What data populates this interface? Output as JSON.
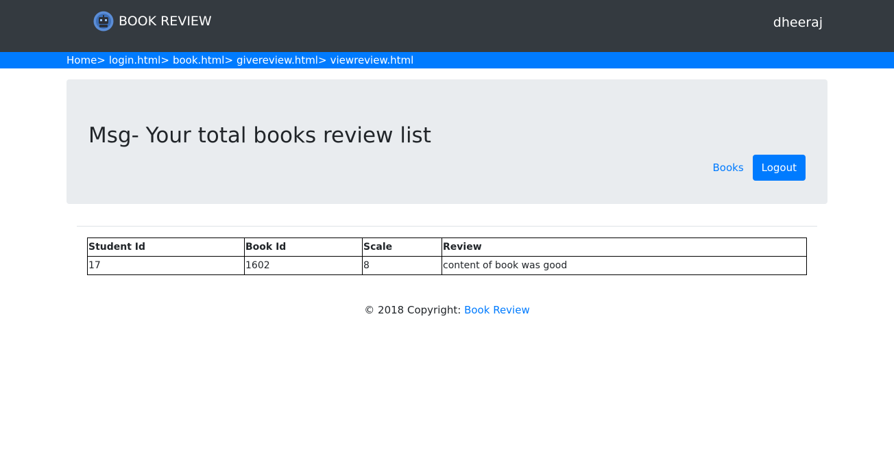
{
  "navbar": {
    "brand_text": "BOOK REVIEW",
    "brand_icon": "robot-logo-icon",
    "username": "dheeraj",
    "bg_color": "#343a40"
  },
  "breadcrumb": {
    "items": [
      {
        "label": "Home",
        "sep": ">"
      },
      {
        "label": "login.html",
        "sep": ">"
      },
      {
        "label": "book.html",
        "sep": ">"
      },
      {
        "label": "givereview.html",
        "sep": ">"
      },
      {
        "label": "viewreview.html",
        "sep": ""
      }
    ],
    "bg_color": "#007bff"
  },
  "jumbotron": {
    "title": "Msg- Your total books review list",
    "books_link": "Books",
    "logout_label": "Logout"
  },
  "table": {
    "headers": [
      "Student Id",
      "Book Id",
      "Scale",
      "Review"
    ],
    "rows": [
      [
        "17",
        "1602",
        "8",
        "content of book was good"
      ]
    ]
  },
  "footer": {
    "copyright_text": "© 2018 Copyright: ",
    "link_text": "Book Review"
  },
  "colors": {
    "accent": "#007bff",
    "jumbotron_bg": "#e9ecef"
  }
}
